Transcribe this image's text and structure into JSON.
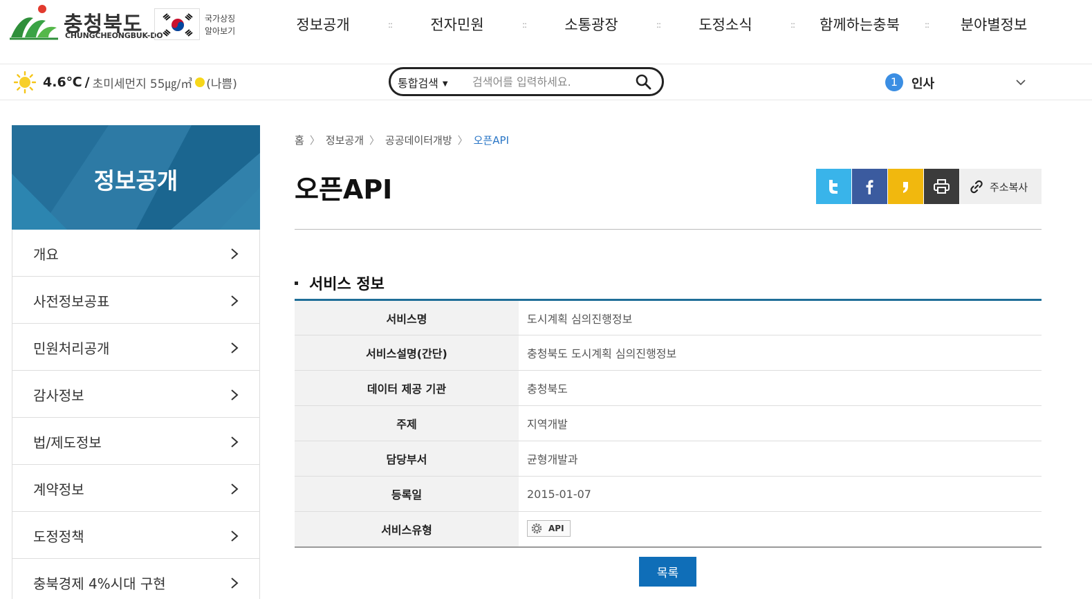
{
  "header": {
    "logo_kr": "충청북도",
    "logo_en": "CHUNGCHEONGBUK-DO",
    "symbol_line1": "국가상징",
    "symbol_line2": "알아보기",
    "nav": [
      "정보공개",
      "전자민원",
      "소통광장",
      "도정소식",
      "함께하는충북",
      "분야별정보"
    ]
  },
  "infobar": {
    "temperature": "4.6℃",
    "slash": "/",
    "dust_label": "초미세먼지",
    "dust_value": "55㎍/㎥",
    "dust_state": "(나쁨)",
    "search_scope": "통합검색",
    "search_placeholder": "검색어를 입력하세요.",
    "rank_number": "1",
    "rank_keyword": "인사"
  },
  "sidebar": {
    "title": "정보공개",
    "items": [
      {
        "label": "개요"
      },
      {
        "label": "사전정보공표"
      },
      {
        "label": "민원처리공개"
      },
      {
        "label": "감사정보"
      },
      {
        "label": "법/제도정보"
      },
      {
        "label": "계약정보"
      },
      {
        "label": "도정정책"
      },
      {
        "label": "충북경제 4%시대 구현"
      }
    ]
  },
  "breadcrumb": [
    "홈",
    "정보공개",
    "공공데이터개방",
    "오픈API"
  ],
  "page_title": "오픈API",
  "share": {
    "copy_label": "주소복사"
  },
  "section_title": "서비스 정보",
  "table": [
    {
      "label": "서비스명",
      "value": "도시계획 심의진행정보"
    },
    {
      "label": "서비스설명(간단)",
      "value": "충청북도 도시계획 심의진행정보"
    },
    {
      "label": "데이터 제공 기관",
      "value": "충청북도"
    },
    {
      "label": "주제",
      "value": "지역개발"
    },
    {
      "label": "담당부서",
      "value": "균형개발과"
    },
    {
      "label": "등록일",
      "value": "2015-01-07"
    },
    {
      "label": "서비스유형",
      "value": "API"
    }
  ],
  "list_button": "목록",
  "colors": {
    "brand_blue": "#1f6e98",
    "button_blue": "#0f6eb8",
    "link_blue": "#2a76c6",
    "twitter": "#39b4ea",
    "facebook": "#3b5b9f",
    "kakaostory": "#f1b80e",
    "print": "#3b3b3b"
  }
}
